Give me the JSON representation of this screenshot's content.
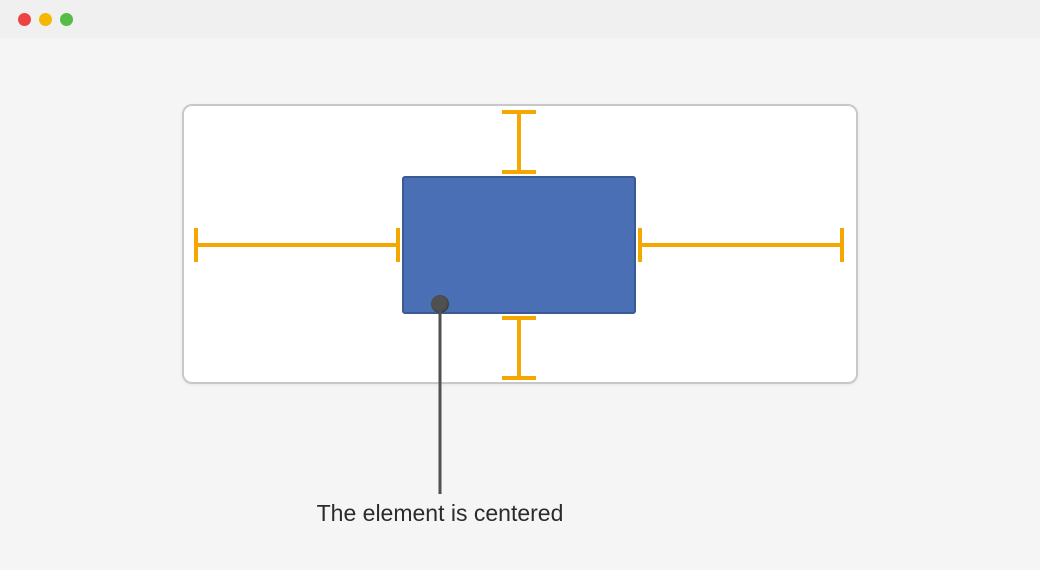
{
  "annotation": {
    "text": "The element is centered"
  },
  "colors": {
    "box_fill": "#4a6fb5",
    "box_border": "#3a5a96",
    "spacer": "#f5a700",
    "canvas_bg": "#ffffff",
    "canvas_border": "#c8c8c8",
    "annotation": "#505050"
  }
}
